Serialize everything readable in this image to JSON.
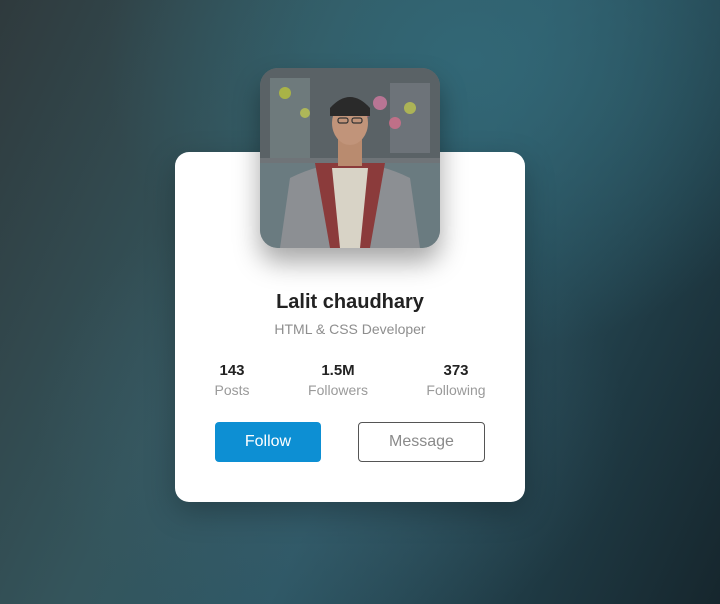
{
  "profile": {
    "name": "Lalit chaudhary",
    "role": "HTML & CSS Developer",
    "avatar_alt": "profile photo"
  },
  "stats": [
    {
      "value": "143",
      "label": "Posts"
    },
    {
      "value": "1.5M",
      "label": "Followers"
    },
    {
      "value": "373",
      "label": "Following"
    }
  ],
  "actions": {
    "follow_label": "Follow",
    "message_label": "Message"
  },
  "colors": {
    "accent": "#0d8fd3",
    "card_bg": "#ffffff"
  }
}
